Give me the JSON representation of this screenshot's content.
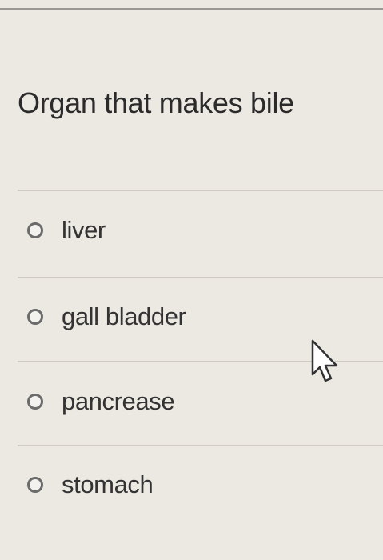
{
  "question": {
    "text": "Organ that makes bile"
  },
  "options": [
    {
      "label": "liver",
      "selected": false
    },
    {
      "label": "gall bladder",
      "selected": false
    },
    {
      "label": "pancrease",
      "selected": false
    },
    {
      "label": "stomach",
      "selected": false
    }
  ],
  "icons": {
    "radio": "radio-empty-circle",
    "cursor": "mouse-pointer-arrow"
  }
}
